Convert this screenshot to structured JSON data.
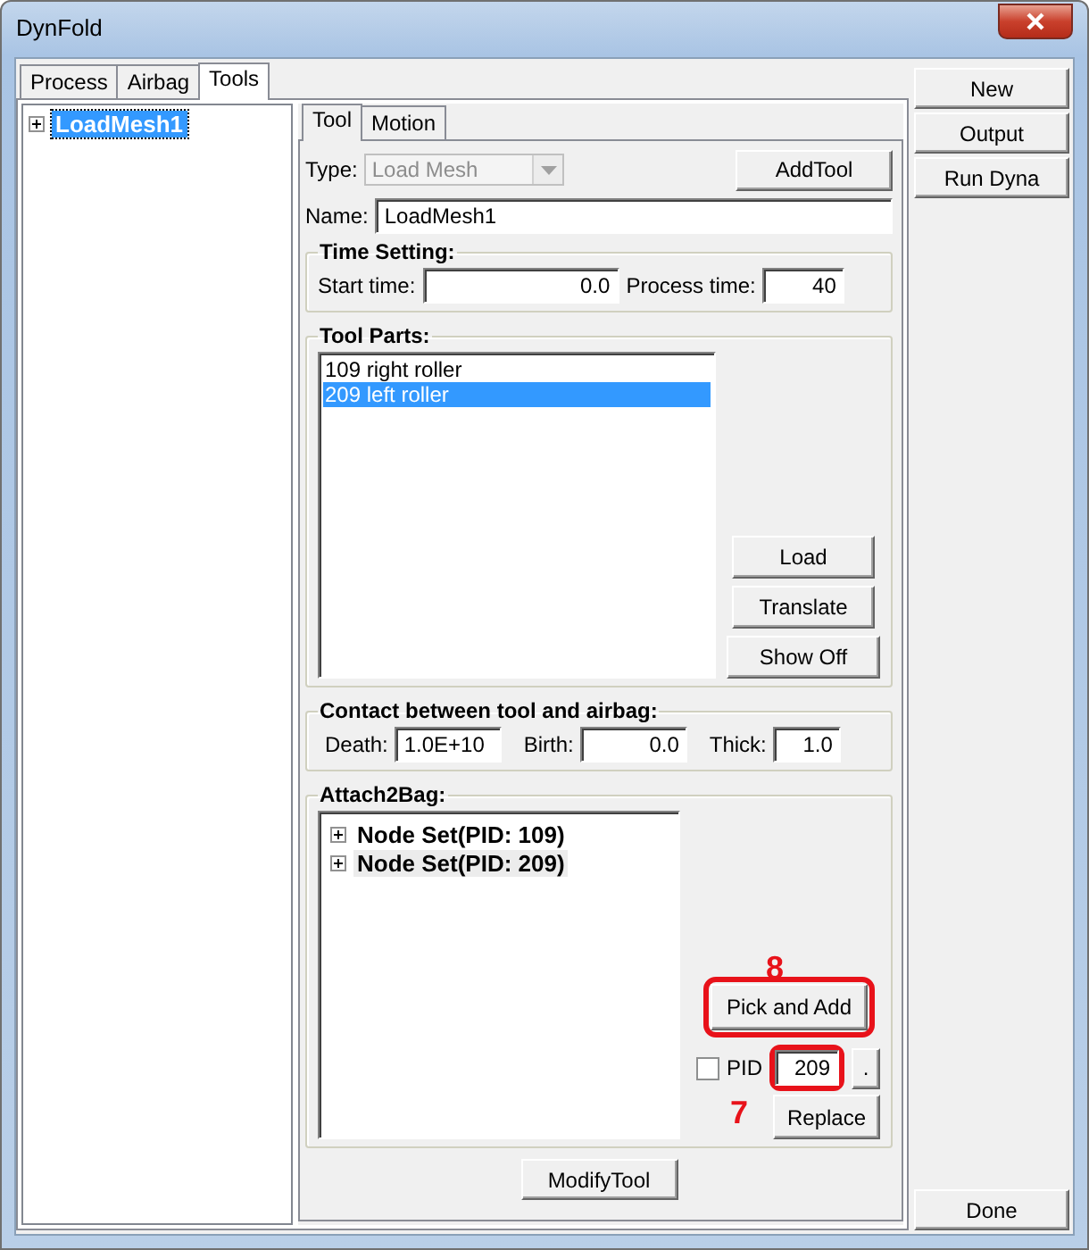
{
  "window": {
    "title": "DynFold"
  },
  "tabs": [
    {
      "label": "Process",
      "selected": false
    },
    {
      "label": "Airbag",
      "selected": false
    },
    {
      "label": "Tools",
      "selected": true
    }
  ],
  "tree": {
    "items": [
      {
        "label": "LoadMesh1",
        "selected": true,
        "expanded": false
      }
    ]
  },
  "tool_tabs": [
    {
      "label": "Tool",
      "selected": true
    },
    {
      "label": "Motion",
      "selected": false
    }
  ],
  "type": {
    "label": "Type:",
    "value": "Load Mesh",
    "disabled": true
  },
  "add_tool_button": "AddTool",
  "name": {
    "label": "Name:",
    "value": "LoadMesh1"
  },
  "time_setting": {
    "title": "Time Setting:",
    "fields": [
      {
        "label": "Start time:",
        "value": "0.0"
      },
      {
        "label": "Process time:",
        "value": "40"
      }
    ]
  },
  "tool_parts": {
    "title": "Tool Parts:",
    "items": [
      {
        "label": "109 right roller",
        "selected": false
      },
      {
        "label": "209 left roller",
        "selected": true
      }
    ],
    "buttons": [
      "Load",
      "Translate",
      "Show Off"
    ]
  },
  "contact": {
    "title": "Contact between tool and airbag:",
    "fields": [
      {
        "label": "Death:",
        "value": "1.0E+10"
      },
      {
        "label": "Birth:",
        "value": "0.0"
      },
      {
        "label": "Thick:",
        "value": "1.0"
      }
    ]
  },
  "attach": {
    "title": "Attach2Bag:",
    "items": [
      {
        "label": "Node Set(PID: 109)",
        "selected": false,
        "expanded": false
      },
      {
        "label": "Node Set(PID: 209)",
        "selected": true,
        "expanded": false
      }
    ],
    "pick_button": {
      "label": "Pick and Add",
      "callout": "8"
    },
    "pid": {
      "label": "PID",
      "checked": false,
      "value": "209",
      "callout": "7"
    },
    "dot_button": ".",
    "replace_button": "Replace"
  },
  "modify_button": "ModifyTool",
  "side_buttons": [
    "New",
    "Output",
    "Run Dyna"
  ],
  "done_button": "Done"
}
